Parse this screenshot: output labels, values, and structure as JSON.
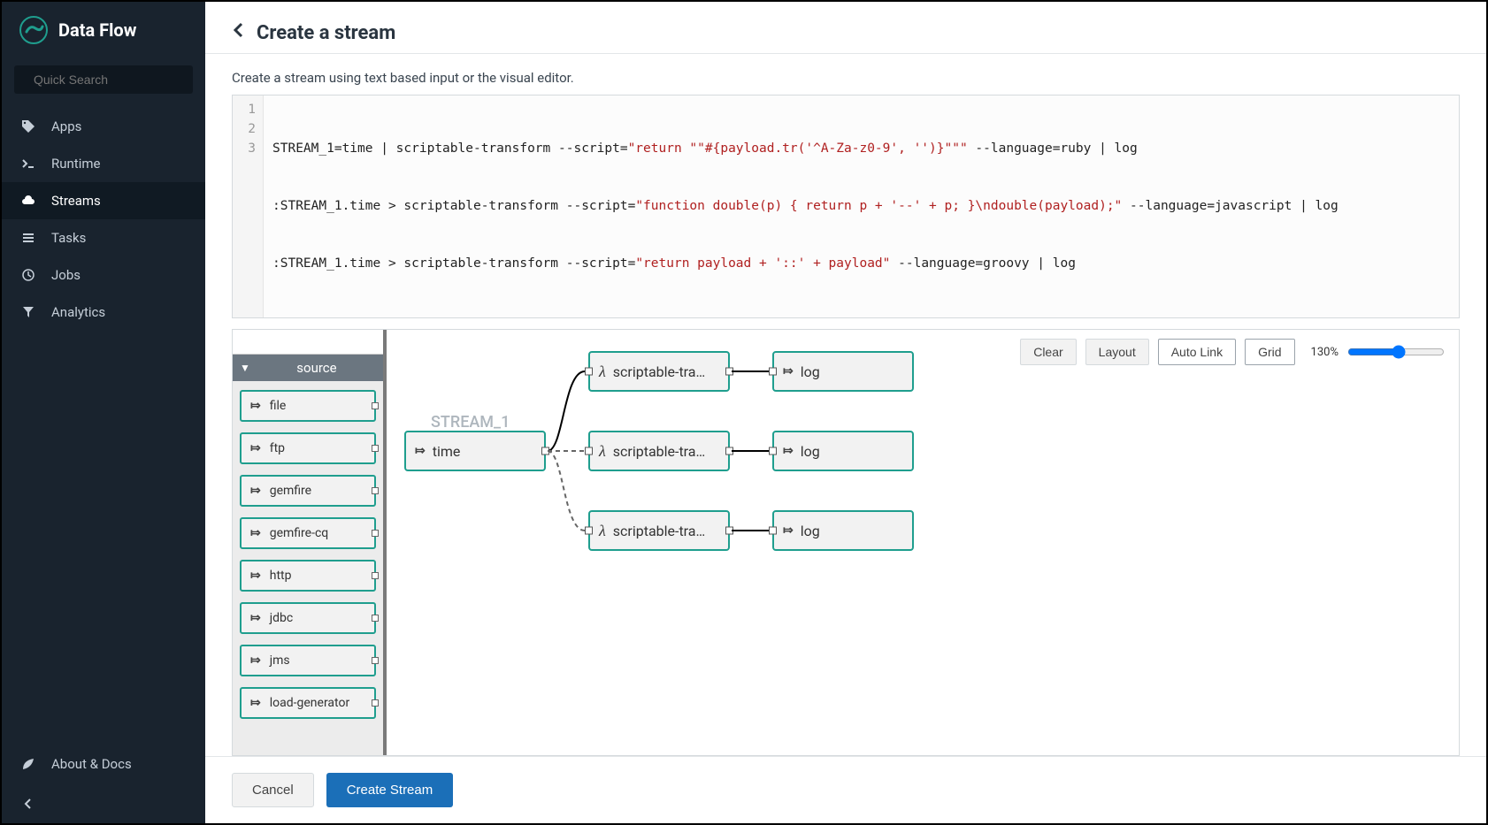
{
  "app": {
    "title": "Data Flow"
  },
  "search": {
    "placeholder": "Quick Search"
  },
  "nav": [
    {
      "id": "apps",
      "label": "Apps",
      "icon": "tag"
    },
    {
      "id": "runtime",
      "label": "Runtime",
      "icon": "prompt"
    },
    {
      "id": "streams",
      "label": "Streams",
      "icon": "cloud",
      "active": true
    },
    {
      "id": "tasks",
      "label": "Tasks",
      "icon": "list"
    },
    {
      "id": "jobs",
      "label": "Jobs",
      "icon": "clock"
    },
    {
      "id": "analytics",
      "label": "Analytics",
      "icon": "funnel"
    }
  ],
  "footer_nav": [
    {
      "id": "about",
      "label": "About & Docs",
      "icon": "leaf"
    },
    {
      "id": "collapse",
      "label": "",
      "icon": "chevron-left"
    }
  ],
  "page": {
    "title": "Create a stream",
    "subtitle": "Create a stream using text based input or the visual editor."
  },
  "code": {
    "lines": [
      {
        "n": 1,
        "pre": "STREAM_1=time | scriptable-transform --script=",
        "str": "\"return \"\"#{payload.tr('^A-Za-z0-9', '')}\"\"\"",
        "post": " --language=ruby | log"
      },
      {
        "n": 2,
        "pre": ":STREAM_1.time > scriptable-transform --script=",
        "str": "\"function double(p) { return p + '--' + p; }\\ndouble(payload);\"",
        "post": " --language=javascript | log"
      },
      {
        "n": 3,
        "pre": ":STREAM_1.time > scriptable-transform --script=",
        "str": "\"return payload + '::' + payload\"",
        "post": " --language=groovy | log"
      }
    ]
  },
  "palette": {
    "header": "source",
    "items": [
      "file",
      "ftp",
      "gemfire",
      "gemfire-cq",
      "http",
      "jdbc",
      "jms",
      "load-generator"
    ]
  },
  "toolbar": {
    "clear": "Clear",
    "layout": "Layout",
    "autolink": "Auto Link",
    "grid": "Grid",
    "zoom": "130%"
  },
  "canvas": {
    "stream_label": "STREAM_1",
    "nodes": {
      "time": "time",
      "transform": "scriptable-tra…",
      "log": "log"
    }
  },
  "buttons": {
    "cancel": "Cancel",
    "create": "Create Stream"
  }
}
